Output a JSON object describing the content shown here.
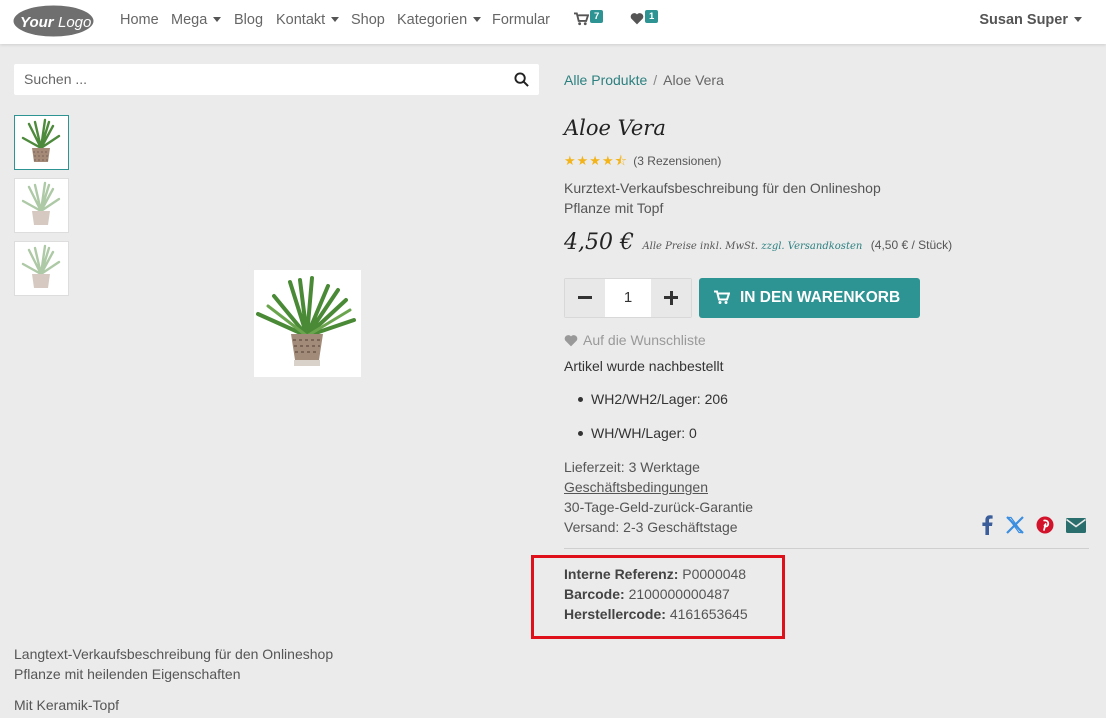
{
  "navbar": {
    "logo_text": "YourLogo",
    "items": [
      {
        "label": "Home"
      },
      {
        "label": "Mega"
      },
      {
        "label": "Blog"
      },
      {
        "label": "Kontakt"
      },
      {
        "label": "Shop"
      },
      {
        "label": "Kategorien"
      },
      {
        "label": "Formular"
      }
    ],
    "cart_count": "7",
    "wishlist_count": "1",
    "user_name": "Susan Super"
  },
  "search": {
    "placeholder": "Suchen ..."
  },
  "breadcrumb": {
    "parent": "Alle Produkte",
    "separator": "/",
    "current": "Aloe Vera"
  },
  "product": {
    "title": "Aloe Vera",
    "rating_value": 4.5,
    "rating_max": 5,
    "reviews": "(3 Rezensionen)",
    "short_desc_line1": "Kurztext-Verkaufsbeschreibung für den Onlineshop",
    "short_desc_line2": "Pflanze mit Topf",
    "price": "4,50 €",
    "price_note_prefix": "Alle Preise inkl. MwSt.",
    "price_note_link": "zzgl. Versandkosten",
    "unit_price": "(4,50 € / Stück)",
    "quantity": "1",
    "add_to_cart": "IN DEN WARENKORB",
    "wishlist": "Auf die Wunschliste",
    "stock_status": "Artikel wurde nachbestellt",
    "stock": [
      "WH2/WH2/Lager: 206",
      "WH/WH/Lager: 0"
    ],
    "delivery_time": "Lieferzeit: 3 Werktage",
    "terms": "Geschäftsbedingungen",
    "guarantee": "30-Tage-Geld-zurück-Garantie",
    "shipping": "Versand: 2-3 Geschäftstage",
    "refs": {
      "internal_label": "Interne Referenz:",
      "internal_value": "P0000048",
      "barcode_label": "Barcode:",
      "barcode_value": "2100000000487",
      "manufacturer_label": "Herstellercode:",
      "manufacturer_value": "4161653645"
    },
    "long_desc_line1": "Langtext-Verkaufsbeschreibung für den Onlineshop",
    "long_desc_line2": "Pflanze mit heilenden Eigenschaften",
    "pot_desc": "Mit Keramik-Topf"
  },
  "share_icons": [
    "facebook-icon",
    "x-twitter-icon",
    "pinterest-icon",
    "email-icon"
  ],
  "colors": {
    "accent": "#2d9393",
    "highlight_box": "#e0101a",
    "star": "#f3b41b"
  }
}
